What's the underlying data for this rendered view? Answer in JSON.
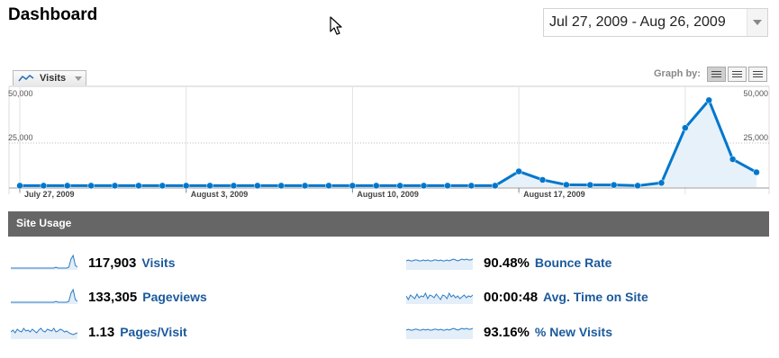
{
  "page": {
    "title": "Dashboard"
  },
  "date_range": {
    "value": "Jul 27, 2009 - Aug 26, 2009"
  },
  "metric_selector": {
    "label": "Visits"
  },
  "graph_by": {
    "label": "Graph by:",
    "options": [
      "day",
      "week",
      "month"
    ],
    "selected": "day"
  },
  "chart_data": {
    "type": "area",
    "series": [
      {
        "name": "Visits",
        "values": [
          800,
          800,
          800,
          800,
          800,
          800,
          800,
          800,
          800,
          800,
          800,
          800,
          800,
          800,
          800,
          800,
          800,
          800,
          800,
          800,
          800,
          8900,
          4100,
          1300,
          1200,
          1200,
          800,
          2400,
          33600,
          49300,
          15800,
          8400
        ]
      }
    ],
    "ylim": [
      0,
      50000
    ],
    "y_ticks": [
      "50,000",
      "25,000"
    ],
    "x_tick_labels": [
      "July 27, 2009",
      "August 3, 2009",
      "August 10, 2009",
      "August 17, 2009"
    ],
    "grid": true,
    "color": "#0077cc"
  },
  "site_usage": {
    "title": "Site Usage",
    "stats": [
      {
        "value": "117,903",
        "label": "Visits",
        "spark": "spike"
      },
      {
        "value": "133,305",
        "label": "Pageviews",
        "spark": "spike"
      },
      {
        "value": "1.13",
        "label": "Pages/Visit",
        "spark": "wavy"
      },
      {
        "value": "90.48%",
        "label": "Bounce Rate",
        "spark": "flat"
      },
      {
        "value": "00:00:48",
        "label": "Avg. Time on Site",
        "spark": "noisy"
      },
      {
        "value": "93.16%",
        "label": "% New Visits",
        "spark": "flat"
      }
    ]
  },
  "colors": {
    "accent": "#0077cc",
    "fill": "#e6f1fa",
    "link": "#1b5a9c",
    "section_bar": "#666666"
  }
}
